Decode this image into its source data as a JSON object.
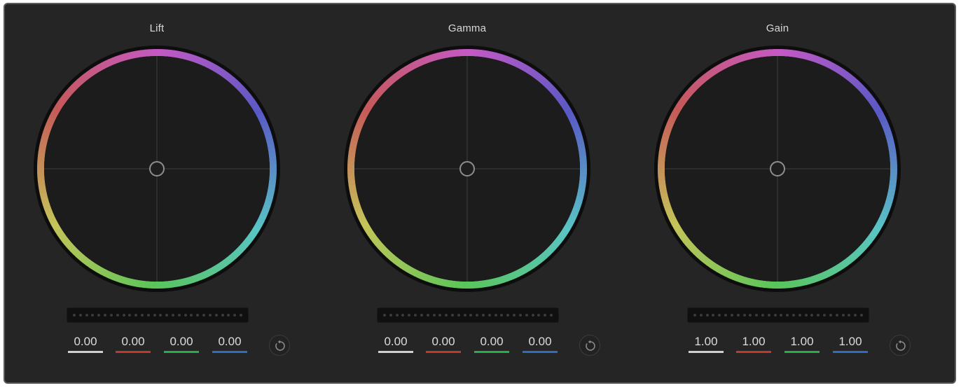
{
  "wheels": [
    {
      "title": "Lift",
      "values": {
        "master": "0.00",
        "red": "0.00",
        "green": "0.00",
        "blue": "0.00"
      }
    },
    {
      "title": "Gamma",
      "values": {
        "master": "0.00",
        "red": "0.00",
        "green": "0.00",
        "blue": "0.00"
      }
    },
    {
      "title": "Gain",
      "values": {
        "master": "1.00",
        "red": "1.00",
        "green": "1.00",
        "blue": "1.00"
      }
    }
  ],
  "colors": {
    "panel": "#252525",
    "wheel_inner": "#1c1c1c",
    "master_underline": "#d0d0d0",
    "red_underline": "#c0392b",
    "green_underline": "#27ae48",
    "blue_underline": "#2e6cc0"
  },
  "icons": {
    "reset": "reset-icon"
  }
}
